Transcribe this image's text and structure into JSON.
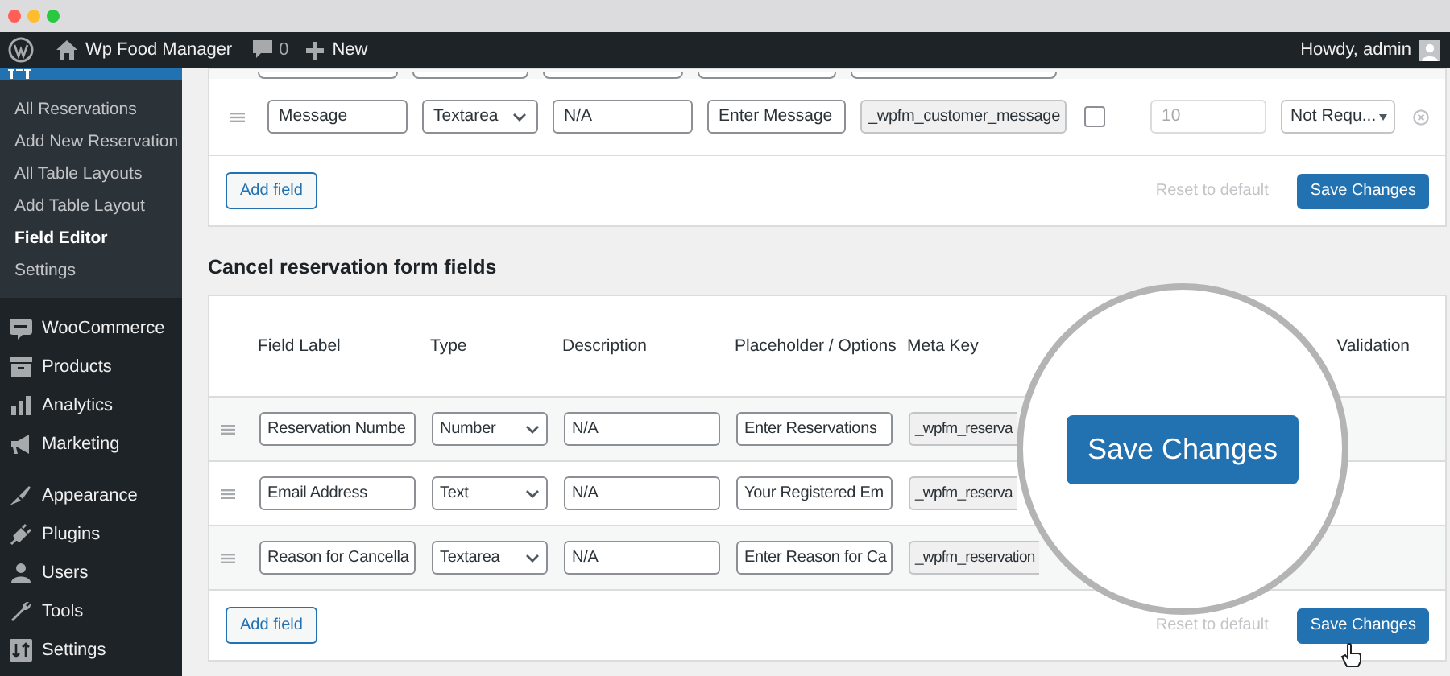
{
  "browser": {
    "dots": [
      {
        "color": "#ff5f57"
      },
      {
        "color": "#febc2e"
      },
      {
        "color": "#28c840"
      }
    ]
  },
  "admin_bar": {
    "site": "Wp Food Manager",
    "comments": "0",
    "new": "New",
    "greeting": "Howdy, admin"
  },
  "sidebar": {
    "submenu": [
      {
        "label": "All Reservations",
        "selected": false
      },
      {
        "label": "Add New Reservation",
        "selected": false
      },
      {
        "label": "All Table Layouts",
        "selected": false
      },
      {
        "label": "Add Table Layout",
        "selected": false
      },
      {
        "label": "Field Editor",
        "selected": true
      },
      {
        "label": "Settings",
        "selected": false
      }
    ],
    "menu_groups": [
      [
        {
          "label": "WooCommerce"
        },
        {
          "label": "Products"
        },
        {
          "label": "Analytics"
        },
        {
          "label": "Marketing"
        }
      ],
      [
        {
          "label": "Appearance"
        },
        {
          "label": "Plugins"
        },
        {
          "label": "Users"
        },
        {
          "label": "Tools"
        },
        {
          "label": "Settings"
        }
      ]
    ]
  },
  "reservation_form": {
    "rows": [
      {
        "label": "Message",
        "type": "Textarea",
        "description": "N/A",
        "placeholder": "Enter Message",
        "meta_key": "_wpfm_customer_message",
        "checked": false,
        "max": "10",
        "validation": "Not Requ..."
      }
    ],
    "add_field": "Add field",
    "reset": "Reset to default",
    "save": "Save Changes"
  },
  "cancel_form": {
    "title": "Cancel reservation form fields",
    "columns": [
      "Field Label",
      "Type",
      "Description",
      "Placeholder / Options",
      "Meta Key",
      "Validation"
    ],
    "rows": [
      {
        "label": "Reservation Numbe",
        "type": "Number",
        "description": "N/A",
        "placeholder": "Enter Reservations",
        "meta_key": "_wpfm_reserva"
      },
      {
        "label": "Email Address",
        "type": "Text",
        "description": "N/A",
        "placeholder": "Your Registered Em",
        "meta_key": "_wpfm_reserva"
      },
      {
        "label": "Reason for Cancella",
        "type": "Textarea",
        "description": "N/A",
        "placeholder": "Enter Reason for Ca",
        "meta_key": "_wpfm_reservation"
      }
    ],
    "add_field": "Add field",
    "reset": "Reset to default",
    "save": "Save Changes"
  },
  "magnifier": {
    "button": "Save Changes"
  }
}
